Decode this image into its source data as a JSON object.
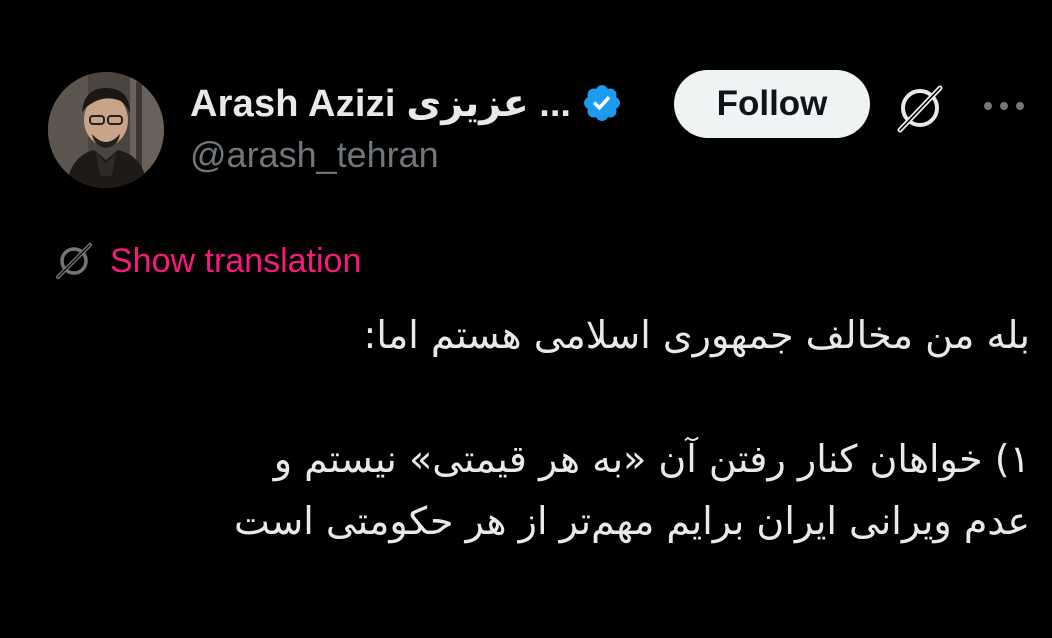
{
  "author": {
    "display_name": "Arash Azizi عزیزی ...",
    "handle": "@arash_tehran",
    "verified": true
  },
  "actions": {
    "follow_label": "Follow"
  },
  "translation": {
    "label": "Show translation"
  },
  "tweet": {
    "lines": [
      "بله من مخالف جمهوری اسلامی هستم اما:",
      "۱) خواهان کنار رفتن آن «به هر قیمتی» نیستم و",
      "عدم ویرانی ایران برایم مهم‌تر از هر حکومتی است"
    ]
  },
  "colors": {
    "background": "#000000",
    "text_primary": "#e7e9ea",
    "text_secondary": "#71767b",
    "follow_bg": "#eff3f4",
    "follow_text": "#0f1419",
    "verified_badge": "#1d9bf0",
    "translate_link": "#f91880"
  },
  "icons": {
    "verified": "verified-badge-icon",
    "grok": "grok-icon",
    "more": "more-options-icon",
    "translate": "grok-translate-icon"
  }
}
